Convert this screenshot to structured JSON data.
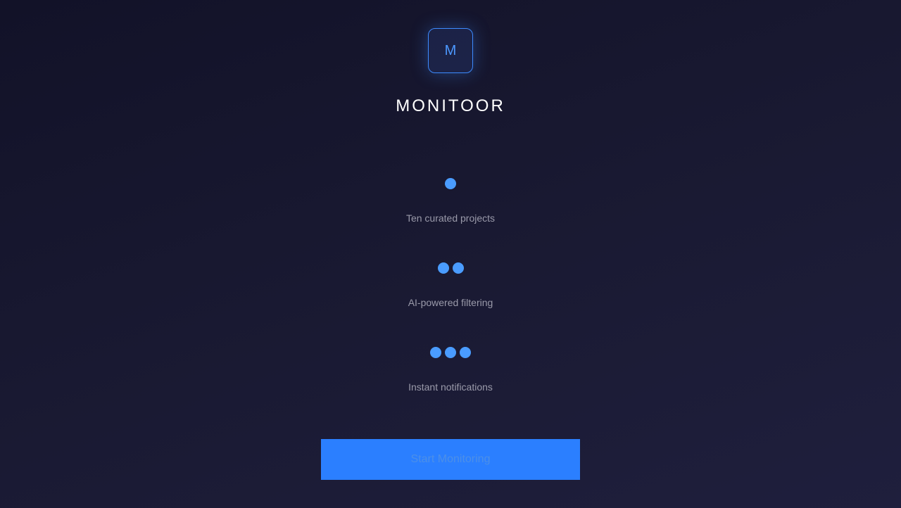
{
  "logo": {
    "letter": "M"
  },
  "app_title": "MONITOOR",
  "features": [
    {
      "dots": 1,
      "label": "Ten curated projects"
    },
    {
      "dots": 2,
      "label": "AI-powered filtering"
    },
    {
      "dots": 3,
      "label": "Instant notifications"
    }
  ],
  "cta": {
    "label": "Start Monitoring"
  },
  "colors": {
    "accent": "#2b7fff",
    "dot": "#4a9cff",
    "background": "#16162e"
  }
}
